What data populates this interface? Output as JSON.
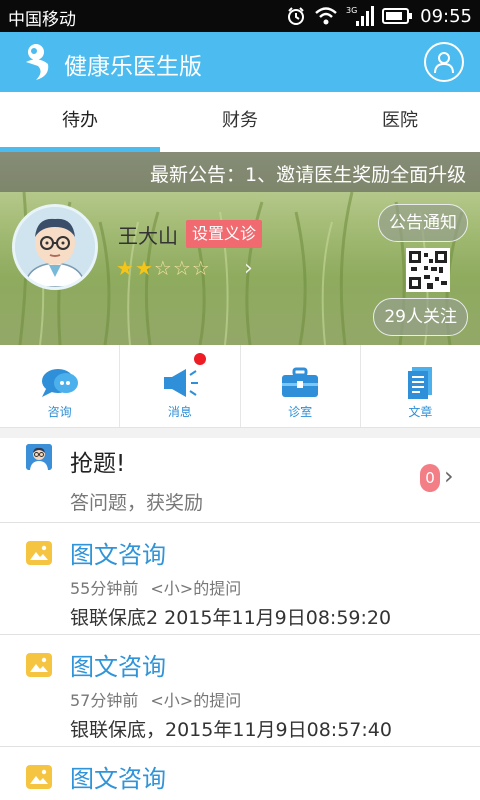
{
  "status_bar": {
    "carrier": "中国移动",
    "network": "3G",
    "time": "09:55"
  },
  "header": {
    "app_title": "健康乐医生版",
    "brand_color": "#4cbcf0",
    "icons": [
      "app-logo",
      "user-profile-icon"
    ]
  },
  "tabs": [
    {
      "label": "待办",
      "active": true
    },
    {
      "label": "财务",
      "active": false
    },
    {
      "label": "医院",
      "active": false
    }
  ],
  "banner": {
    "notice": "最新公告：1、邀请医生奖励全面升级",
    "doctor_name": "王大山",
    "set_clinic_label": "设置义诊",
    "rating": 2,
    "rating_max": 5,
    "announce_label": "公告通知",
    "followers_label": "29人关注"
  },
  "quick_actions": [
    {
      "label": "咨询",
      "icon": "chat-bubble-icon"
    },
    {
      "label": "消息",
      "icon": "megaphone-icon",
      "has_unread": true
    },
    {
      "label": "诊室",
      "icon": "briefcase-icon"
    },
    {
      "label": "文章",
      "icon": "article-icon"
    }
  ],
  "grab_question": {
    "title": "抢题!",
    "subtitle": "答问题，获奖励",
    "count": "0"
  },
  "consultations": [
    {
      "type": "图文咨询",
      "time_ago": "55分钟前",
      "asker": "<小>的提问",
      "title": "银联保底2  2015年11月9日08:59:20"
    },
    {
      "type": "图文咨询",
      "time_ago": "57分钟前",
      "asker": "<小>的提问",
      "title": "银联保底，2015年11月9日08:57:40"
    },
    {
      "type": "图文咨询",
      "time_ago": "",
      "asker": "",
      "title": ""
    }
  ]
}
